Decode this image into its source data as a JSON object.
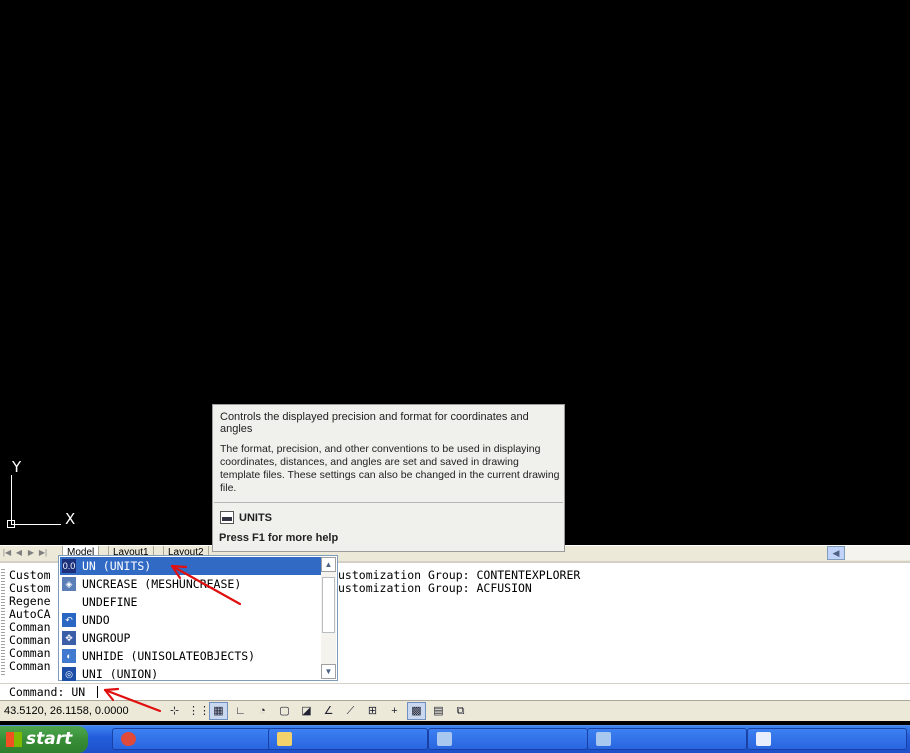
{
  "ucs": {
    "x_label": "X",
    "y_label": "Y"
  },
  "layout_tabs": [
    "Model",
    "Layout1",
    "Layout2"
  ],
  "command_history": [
    {
      "left": "Custom",
      "right": "ustomization Group: CONTENTEXPLORER"
    },
    {
      "left": "Custom",
      "right": "ustomization Group: ACFUSION"
    },
    {
      "left": "Regene",
      "right": ""
    },
    {
      "left": "AutoCA",
      "right": ""
    },
    {
      "left": "Comman",
      "right": ""
    },
    {
      "left": "Comman",
      "right": ""
    },
    {
      "left": "Comman",
      "right": ""
    },
    {
      "left": "Comman",
      "right": ""
    }
  ],
  "command_line": {
    "prompt": "Command: ",
    "value": "UN"
  },
  "autocomplete": {
    "items": [
      {
        "label": "UN (UNITS)",
        "icon": "units-icon",
        "selected": true
      },
      {
        "label": "UNCREASE (MESHUNCREASE)",
        "icon": "uncrease-icon"
      },
      {
        "label": "UNDEFINE",
        "icon": ""
      },
      {
        "label": "UNDO",
        "icon": "undo-icon"
      },
      {
        "label": "UNGROUP",
        "icon": "ungroup-icon"
      },
      {
        "label": "UNHIDE (UNISOLATEOBJECTS)",
        "icon": "unhide-icon"
      },
      {
        "label": "UNI (UNION)",
        "icon": "union-icon"
      }
    ]
  },
  "tooltip": {
    "title": "Controls the displayed precision and format for coordinates and angles",
    "description": "The format, precision, and other conventions to be used in displaying coordinates, distances, and angles are set and saved in drawing template files. These settings can also be changed in the current drawing file.",
    "command": "UNITS",
    "help": "Press F1 for more help"
  },
  "status_bar": {
    "coordinates": "43.5120, 26.1158, 0.0000",
    "toggles": [
      "snap-icon",
      "grid-icon",
      "grid-display-icon",
      "ortho-icon",
      "polar-icon",
      "osnap-icon",
      "3dosnap-icon",
      "otrack-icon",
      "ducs-icon",
      "dyn-icon",
      "lweight-icon",
      "transparency-icon",
      "qp-icon",
      "sc-icon"
    ]
  },
  "taskbar": {
    "start_label": "start",
    "tasks": [
      "chrome-icon",
      "folder-icon",
      "autocad-icon",
      "autocad-icon",
      "word-icon"
    ]
  },
  "colors": {
    "selection": "#316ac5",
    "annotation_arrow": "#e01010",
    "canvas": "#000000"
  }
}
